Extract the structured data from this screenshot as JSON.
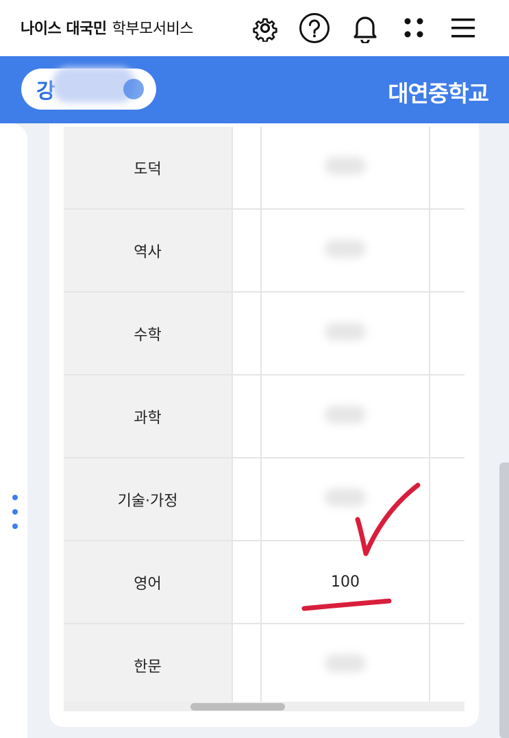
{
  "app": {
    "brand_bold": "나이스 대국민",
    "brand_light": "학부모서비스"
  },
  "header": {
    "student_initial": "강",
    "school_name": "대연중학교"
  },
  "top_icons": [
    "gear-icon",
    "help-icon",
    "bell-icon",
    "apps-icon",
    "menu-icon"
  ],
  "grades": {
    "rows": [
      {
        "subject": "도덕",
        "score": ""
      },
      {
        "subject": "역사",
        "score": ""
      },
      {
        "subject": "수학",
        "score": ""
      },
      {
        "subject": "과학",
        "score": ""
      },
      {
        "subject": "기술·가정",
        "score": ""
      },
      {
        "subject": "영어",
        "score": "100"
      },
      {
        "subject": "한문",
        "score": ""
      }
    ]
  },
  "colors": {
    "accent": "#3f7de8",
    "annotation": "#d91e3c"
  }
}
